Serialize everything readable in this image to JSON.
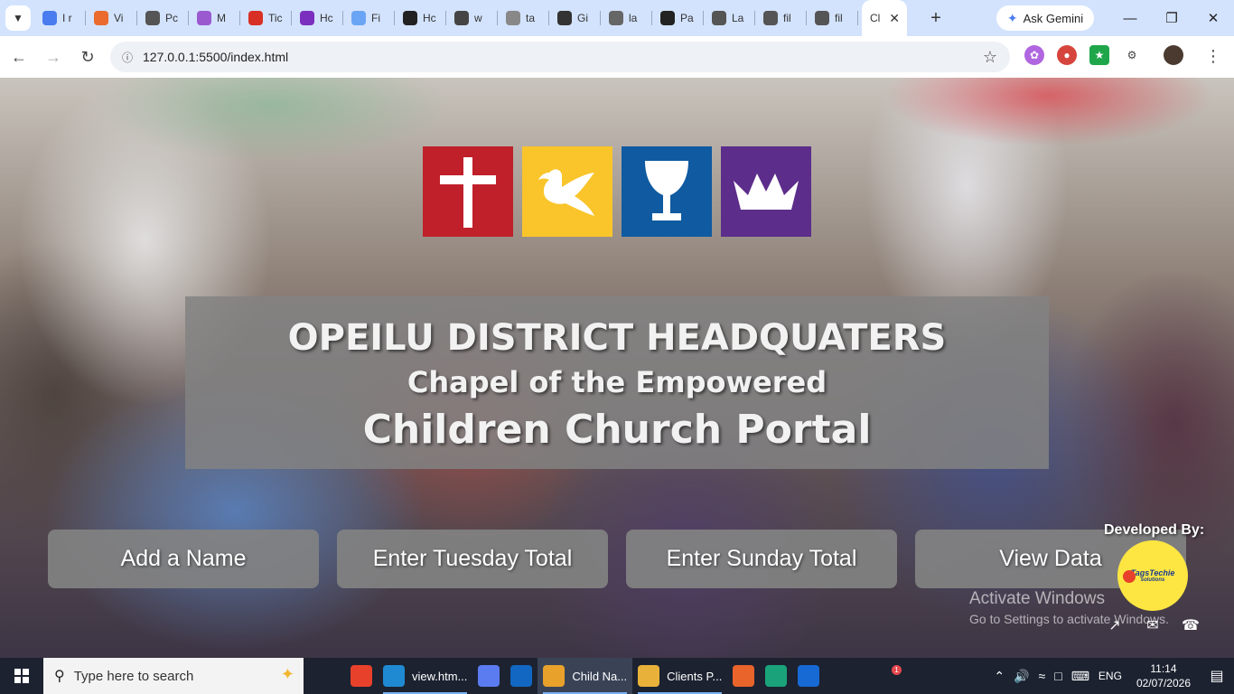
{
  "browser": {
    "tabs": [
      {
        "title": "I r",
        "icon": "gemini-icon",
        "color": "#4a7cf0"
      },
      {
        "title": "Vi",
        "icon": "gmail-icon",
        "color": "#ea6b2d"
      },
      {
        "title": "Pc",
        "icon": "chatgpt-icon",
        "color": "#555555"
      },
      {
        "title": "M",
        "icon": "flower-icon",
        "color": "#9b59d0"
      },
      {
        "title": "Tic",
        "icon": "gmail-icon",
        "color": "#d93025"
      },
      {
        "title": "Hc",
        "icon": "h-logo-icon",
        "color": "#7b2fbe"
      },
      {
        "title": "Fi",
        "icon": "h-logo-icon",
        "color": "#6aa5f5"
      },
      {
        "title": "Hc",
        "icon": "dark-square-icon",
        "color": "#222222"
      },
      {
        "title": "w",
        "icon": "whatsapp-icon",
        "color": "#444444"
      },
      {
        "title": "ta",
        "icon": "image-icon",
        "color": "#888888"
      },
      {
        "title": "Gi",
        "icon": "diamond-icon",
        "color": "#333333"
      },
      {
        "title": "la",
        "icon": "star-box-icon",
        "color": "#666666"
      },
      {
        "title": "Pa",
        "icon": "github-icon",
        "color": "#222222"
      },
      {
        "title": "La",
        "icon": "globe-icon",
        "color": "#555555"
      },
      {
        "title": "fil",
        "icon": "globe-icon",
        "color": "#555555"
      },
      {
        "title": "fil",
        "icon": "globe-icon",
        "color": "#555555"
      }
    ],
    "active_tab": {
      "title": "Cl"
    },
    "gemini_label": "Ask Gemini",
    "url": "127.0.0.1:5500/index.html"
  },
  "page": {
    "logos": [
      {
        "name": "cross-icon",
        "color": "#c0202a"
      },
      {
        "name": "dove-icon",
        "color": "#f9c52a"
      },
      {
        "name": "chalice-icon",
        "color": "#0f5aa0"
      },
      {
        "name": "crown-icon",
        "color": "#5c2d8a"
      }
    ],
    "title_main": "OPEILU DISTRICT HEADQUATERS",
    "title_sub": "Chapel of the Empowered",
    "title_portal": "Children Church Portal",
    "buttons": {
      "add_name": "Add a Name",
      "tuesday": "Enter Tuesday Total",
      "sunday": "Enter Sunday Total",
      "view": "View Data"
    },
    "developed_by": "Developed By:",
    "dev_logo_text": "TagsTechie",
    "dev_logo_small": "solutions",
    "activate_title": "Activate Windows",
    "activate_sub": "Go to Settings to activate Windows."
  },
  "taskbar": {
    "search_placeholder": "Type here to search",
    "items": [
      {
        "label": "",
        "icon": "task-view-icon",
        "color": "#1c2230"
      },
      {
        "label": "",
        "icon": "app-icon",
        "color": "#e8412b"
      },
      {
        "label": "view.htm...",
        "icon": "vscode-icon",
        "color": "#1f8ad2"
      },
      {
        "label": "",
        "icon": "copilot-icon",
        "color": "#5b7cf0"
      },
      {
        "label": "",
        "icon": "outlook-icon",
        "color": "#1267c2"
      },
      {
        "label": "Child Na...",
        "icon": "chrome-icon",
        "color": "#e8a12b"
      },
      {
        "label": "Clients P...",
        "icon": "folder-icon",
        "color": "#e8b23a"
      },
      {
        "label": "",
        "icon": "firefox-icon",
        "color": "#e8642b"
      },
      {
        "label": "",
        "icon": "edge-icon",
        "color": "#1aa37a"
      },
      {
        "label": "",
        "icon": "teamviewer-icon",
        "color": "#1769d4"
      }
    ],
    "badge": "1",
    "language": "ENG",
    "time": "11:14",
    "date": "02/07/2026"
  }
}
